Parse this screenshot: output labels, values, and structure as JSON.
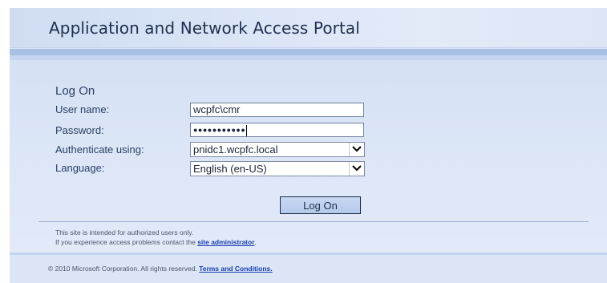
{
  "header": {
    "title": "Application and Network Access Portal"
  },
  "form": {
    "heading": "Log On",
    "username": {
      "label": "User name:",
      "value": "wcpfc\\cmr"
    },
    "password": {
      "label": "Password:",
      "masked_value": "●●●●●●●●●●●"
    },
    "authenticate": {
      "label": "Authenticate using:",
      "selected": "pnidc1.wcpfc.local"
    },
    "language": {
      "label": "Language:",
      "selected": "English (en-US)"
    },
    "submit_label": "Log On"
  },
  "notice": {
    "line1": "This site is intended for authorized users only.",
    "line2_prefix": "If you experience access problems contact the ",
    "line2_link": "site administrator",
    "line2_suffix": "."
  },
  "footer": {
    "copyright": "© 2010 Microsoft Corporation. All rights reserved. ",
    "terms_link": "Terms and Conditions."
  },
  "icons": {
    "dropdown": "chevron-down-icon"
  }
}
